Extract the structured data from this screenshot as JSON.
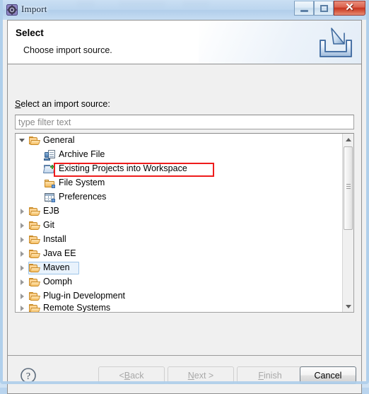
{
  "window": {
    "title": "Import",
    "icon": "eclipse-import-icon",
    "controls": {
      "minimize": "minimize-button",
      "maximize": "maximize-button",
      "close": "✕"
    }
  },
  "header": {
    "title": "Select",
    "subtitle": "Choose import source.",
    "banner_icon": "import-arrow-tray-icon"
  },
  "form": {
    "source_label_mnemonic": "S",
    "source_label_rest": "elect an import source:",
    "filter_placeholder": "type filter text",
    "filter_value": ""
  },
  "tree": {
    "items": [
      {
        "label": "General",
        "depth": 0,
        "expander": "expanded",
        "icon": "folder-open-icon",
        "state": "normal"
      },
      {
        "label": "Archive File",
        "depth": 1,
        "expander": "none",
        "icon": "archive-file-icon",
        "state": "normal"
      },
      {
        "label": "Existing Projects into Workspace",
        "depth": 1,
        "expander": "none",
        "icon": "import-project-icon",
        "state": "highlighted"
      },
      {
        "label": "File System",
        "depth": 1,
        "expander": "none",
        "icon": "folder-closed-icon",
        "state": "normal"
      },
      {
        "label": "Preferences",
        "depth": 1,
        "expander": "none",
        "icon": "preferences-table-icon",
        "state": "normal"
      },
      {
        "label": "EJB",
        "depth": 0,
        "expander": "collapsed",
        "icon": "folder-open-icon",
        "state": "normal"
      },
      {
        "label": "Git",
        "depth": 0,
        "expander": "collapsed",
        "icon": "folder-open-icon",
        "state": "normal"
      },
      {
        "label": "Install",
        "depth": 0,
        "expander": "collapsed",
        "icon": "folder-open-icon",
        "state": "normal"
      },
      {
        "label": "Java EE",
        "depth": 0,
        "expander": "collapsed",
        "icon": "folder-open-icon",
        "state": "normal"
      },
      {
        "label": "Maven",
        "depth": 0,
        "expander": "collapsed",
        "icon": "folder-open-icon",
        "state": "selected"
      },
      {
        "label": "Oomph",
        "depth": 0,
        "expander": "collapsed",
        "icon": "folder-open-icon",
        "state": "normal"
      },
      {
        "label": "Plug-in Development",
        "depth": 0,
        "expander": "collapsed",
        "icon": "folder-open-icon",
        "state": "normal"
      },
      {
        "label": "Remote Systems",
        "depth": 0,
        "expander": "collapsed",
        "icon": "folder-open-icon",
        "state": "clipped"
      }
    ],
    "scrollbar": {
      "up_arrow": "scroll-up-arrow",
      "down_arrow": "scroll-down-arrow",
      "thumb": "scroll-thumb"
    }
  },
  "buttons": {
    "help": "?",
    "back": {
      "pre": "< ",
      "mnem": "B",
      "post": "ack",
      "enabled": false
    },
    "next": {
      "pre": "",
      "mnem": "N",
      "post": "ext >",
      "enabled": false
    },
    "finish": {
      "pre": "",
      "mnem": "F",
      "post": "inish",
      "enabled": false
    },
    "cancel": {
      "pre": "",
      "mnem": "",
      "post": "Cancel",
      "enabled": true
    }
  },
  "annotation": {
    "highlight_color": "#ee1c1c",
    "highlight_target": "Existing Projects into Workspace"
  }
}
